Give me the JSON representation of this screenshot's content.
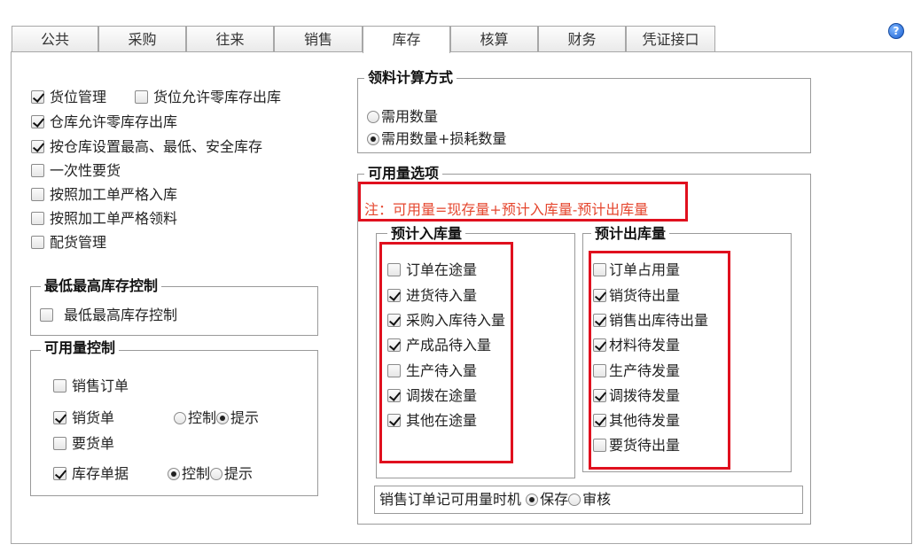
{
  "tabs": [
    "公共",
    "采购",
    "往来",
    "销售",
    "库存",
    "核算",
    "财务",
    "凭证接口"
  ],
  "active_tab": "库存",
  "help_icon": "question-icon",
  "left_options": [
    {
      "label": "货位管理",
      "checked": true
    },
    {
      "label": "货位允许零库存出库",
      "checked": false
    },
    {
      "label": "仓库允许零库存出库",
      "checked": true
    },
    {
      "label": "按仓库设置最高、最低、安全库存",
      "checked": true
    },
    {
      "label": "一次性要货",
      "checked": false
    },
    {
      "label": "按照加工单严格入库",
      "checked": false
    },
    {
      "label": "按照加工单严格领料",
      "checked": false
    },
    {
      "label": "配货管理",
      "checked": false
    }
  ],
  "minmax": {
    "title": "最低最高库存控制",
    "option": {
      "label": "最低最高库存控制",
      "checked": false
    }
  },
  "avail_control": {
    "title": "可用量控制",
    "rows": {
      "sales_order": {
        "label": "销售订单",
        "checked": false
      },
      "delivery": {
        "label": "销货单",
        "checked": true,
        "control": "控制",
        "hint": "提示",
        "selected": "提示"
      },
      "requisition": {
        "label": "要货单",
        "checked": false
      },
      "stock_doc": {
        "label": "库存单据",
        "checked": true,
        "control": "控制",
        "hint": "提示",
        "selected": "控制"
      }
    }
  },
  "picking": {
    "title": "领料计算方式",
    "opt1": "需用数量",
    "opt2": "需用数量+损耗数量",
    "selected": "需用数量+损耗数量"
  },
  "avail_options": {
    "title": "可用量选项",
    "note": "注：可用量=现存量+预计入库量-预计出库量",
    "incoming": {
      "title": "预计入库量",
      "items": [
        {
          "label": "订单在途量",
          "checked": false
        },
        {
          "label": "进货待入量",
          "checked": true
        },
        {
          "label": "采购入库待入量",
          "checked": true
        },
        {
          "label": "产成品待入量",
          "checked": true
        },
        {
          "label": "生产待入量",
          "checked": false
        },
        {
          "label": "调拨在途量",
          "checked": true
        },
        {
          "label": "其他在途量",
          "checked": true
        }
      ]
    },
    "outgoing": {
      "title": "预计出库量",
      "items": [
        {
          "label": "订单占用量",
          "checked": false
        },
        {
          "label": "销货待出量",
          "checked": true
        },
        {
          "label": "销售出库待出量",
          "checked": true
        },
        {
          "label": "材料待发量",
          "checked": true
        },
        {
          "label": "生产待发量",
          "checked": false
        },
        {
          "label": "调拨待发量",
          "checked": true
        },
        {
          "label": "其他待发量",
          "checked": true
        },
        {
          "label": "要货待出量",
          "checked": false
        }
      ]
    },
    "timing": {
      "label": "销售订单记可用量时机",
      "save": "保存",
      "audit": "审核",
      "selected": "保存"
    }
  },
  "colors": {
    "highlight": "#e0101e",
    "note_text": "#e5462e"
  }
}
